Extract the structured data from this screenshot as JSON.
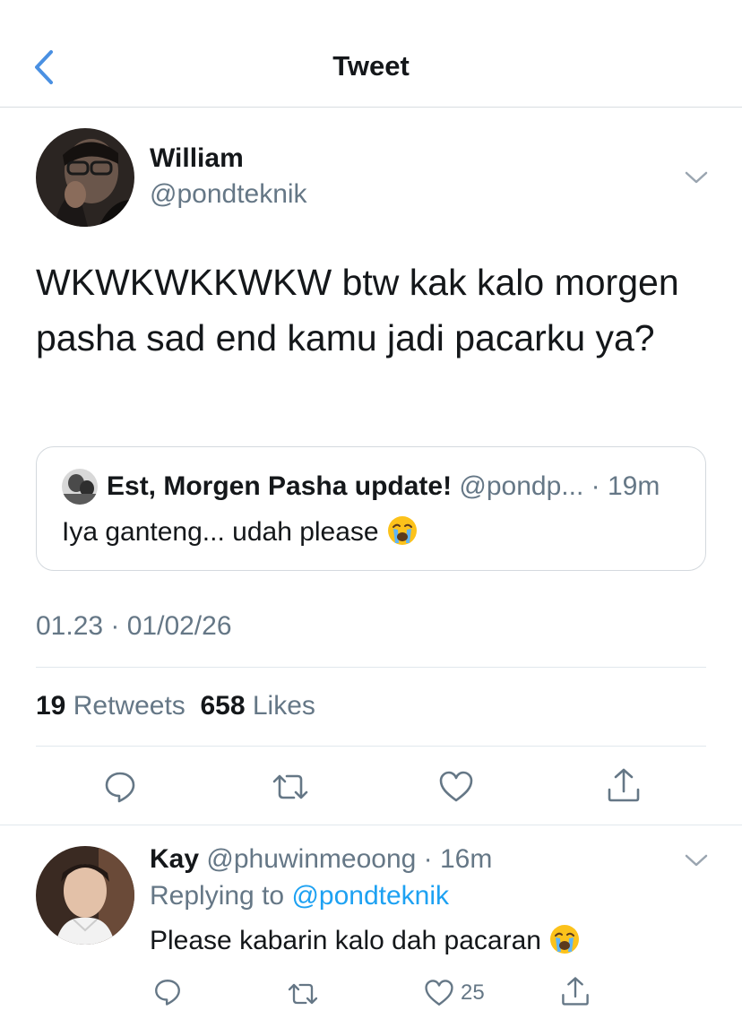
{
  "header": {
    "title": "Tweet"
  },
  "tweet": {
    "author_name": "William",
    "author_handle": "@pondteknik",
    "text": "WKWKWKKWKW btw kak kalo morgen pasha sad end kamu jadi pacarku ya?",
    "quote": {
      "name": "Est, Morgen Pasha update!",
      "handle_and_time": "@pondp... · 19m",
      "text": "Iya ganteng... udah please"
    },
    "timestamp": "01.23 · 01/02/26",
    "retweet_count": "19",
    "retweet_label": "Retweets",
    "like_count": "658",
    "like_label": "Likes"
  },
  "reply": {
    "name": "Kay",
    "handle_and_time": "@phuwinmeoong · 16m",
    "replying_prefix": "Replying to",
    "replying_to": "@pondteknik",
    "text": "Please kabarin kalo dah pacaran",
    "like_count": "25"
  },
  "colors": {
    "accent": "#1da1f2",
    "secondary_text": "#657786",
    "divider": "#e1e8ed",
    "back_chevron": "#4a90e2"
  },
  "icons": [
    "back-chevron-icon",
    "dropdown-chevron-icon",
    "reply-icon",
    "retweet-icon",
    "like-icon",
    "share-icon",
    "crying-face-emoji"
  ]
}
